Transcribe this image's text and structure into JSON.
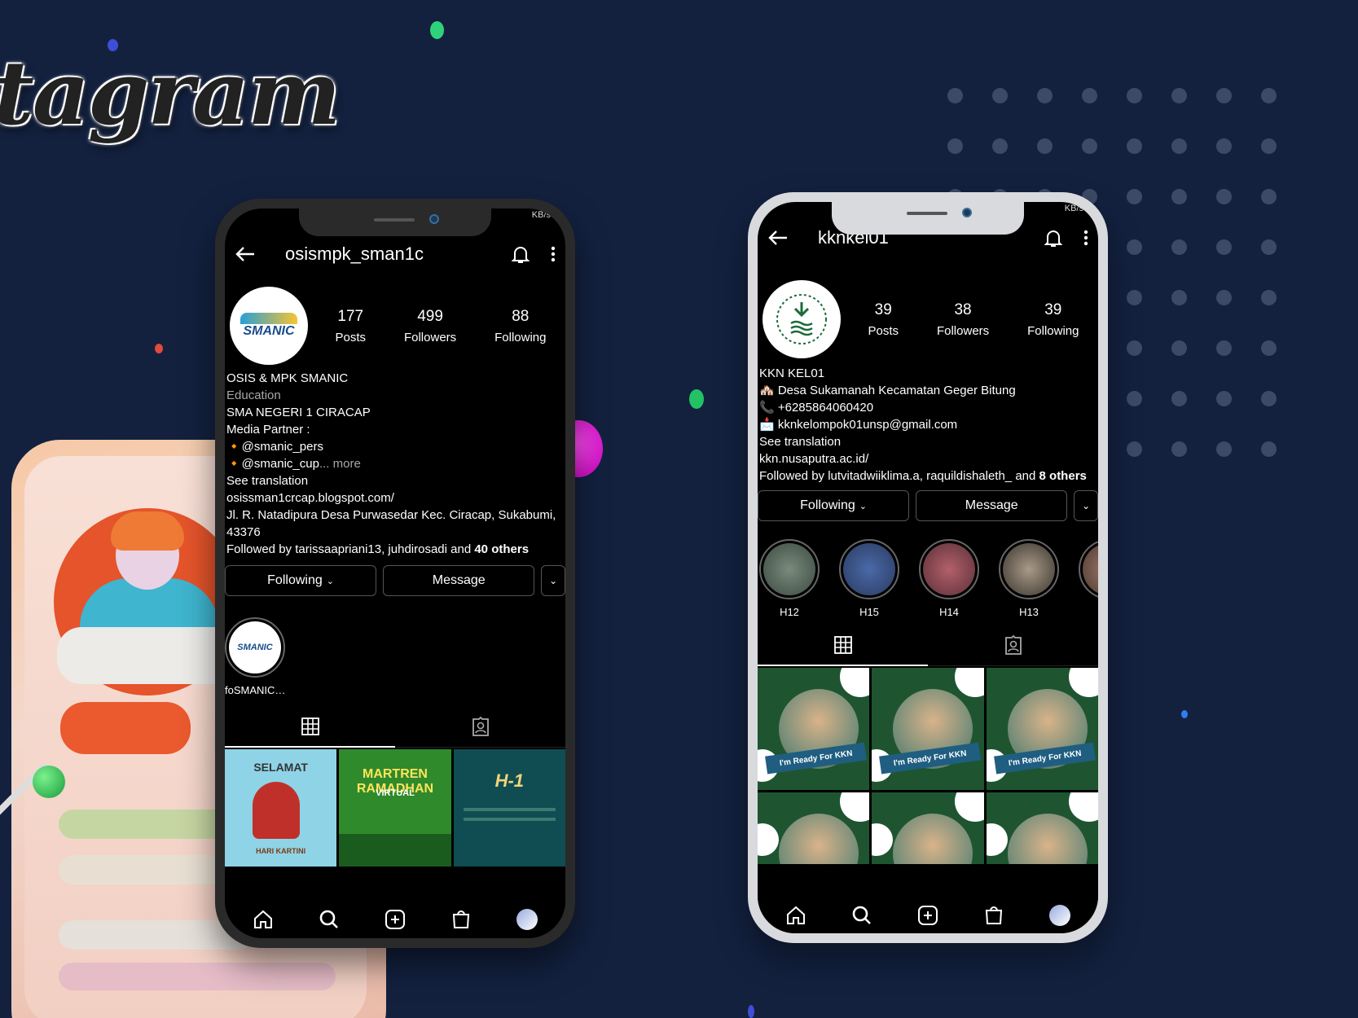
{
  "brand_text": "tagram",
  "colors": {
    "background": "#13213f",
    "dark_phone": "#2a2a2a",
    "light_phone": "#d8dadd",
    "green_post": "#1e5530"
  },
  "phone_left": {
    "status_right": "KB/s",
    "username": "osismpk_sman1c",
    "avatar_logo_text": "SMANIC",
    "stats": [
      {
        "value": "177",
        "label": "Posts"
      },
      {
        "value": "499",
        "label": "Followers"
      },
      {
        "value": "88",
        "label": "Following"
      }
    ],
    "bio": {
      "name": "OSIS & MPK SMANIC",
      "category": "Education",
      "line1": "SMA NEGERI 1 CIRACAP",
      "line2": "Media Partner :",
      "line3": "🔸@smanic_pers",
      "line4_main": "🔸@smanic_cup",
      "line4_more": "... more",
      "translation": "See translation",
      "link": "osissman1crcap.blogspot.com/",
      "address": "Jl. R. Natadipura Desa Purwasedar Kec. Ciracap, Sukabumi, 43376",
      "followed_prefix": "Followed by tarissaapriani13, juhdirosadi and ",
      "followed_bold": "40 others"
    },
    "buttons": {
      "following": "Following",
      "message": "Message"
    },
    "highlights": [
      {
        "label": "foSMANICC..."
      }
    ],
    "posts": [
      {
        "title": "SELAMAT",
        "subtitle": "HARI KARTINI"
      },
      {
        "title": "MARTREN RAMADHAN",
        "subtitle": "VIRTUAL"
      },
      {
        "title": "H-1",
        "subtitle": ""
      }
    ]
  },
  "phone_right": {
    "status_right": "KB/s",
    "username": "kknkel01",
    "stats": [
      {
        "value": "39",
        "label": "Posts"
      },
      {
        "value": "38",
        "label": "Followers"
      },
      {
        "value": "39",
        "label": "Following"
      }
    ],
    "bio": {
      "name": "KKN KEL01",
      "line1": "🏘️ Desa Sukamanah Kecamatan Geger Bitung",
      "line2": "📞 +6285864060420",
      "line3": "📩 kknkelompok01unsp@gmail.com",
      "translation": "See translation",
      "link": "kkn.nusaputra.ac.id/",
      "followed_prefix": "Followed by lutvitadwiiklima.a, raquildishaleth_ and ",
      "followed_bold": "8 others"
    },
    "buttons": {
      "following": "Following",
      "message": "Message"
    },
    "highlights": [
      {
        "label": "H12"
      },
      {
        "label": "H15"
      },
      {
        "label": "H14"
      },
      {
        "label": "H13"
      }
    ],
    "posts": [
      {
        "caption": "I'm Ready For KKN"
      },
      {
        "caption": "I'm Ready For KKN"
      },
      {
        "caption": "I'm Ready For KKN"
      },
      {
        "caption": ""
      },
      {
        "caption": ""
      },
      {
        "caption": ""
      }
    ]
  },
  "icons": {
    "back": "arrow-left-icon",
    "bell": "bell-icon",
    "more": "more-vertical-icon",
    "grid": "grid-icon",
    "tagged": "tagged-icon",
    "home": "home-icon",
    "search": "search-icon",
    "add": "add-post-icon",
    "shop": "shop-icon"
  }
}
